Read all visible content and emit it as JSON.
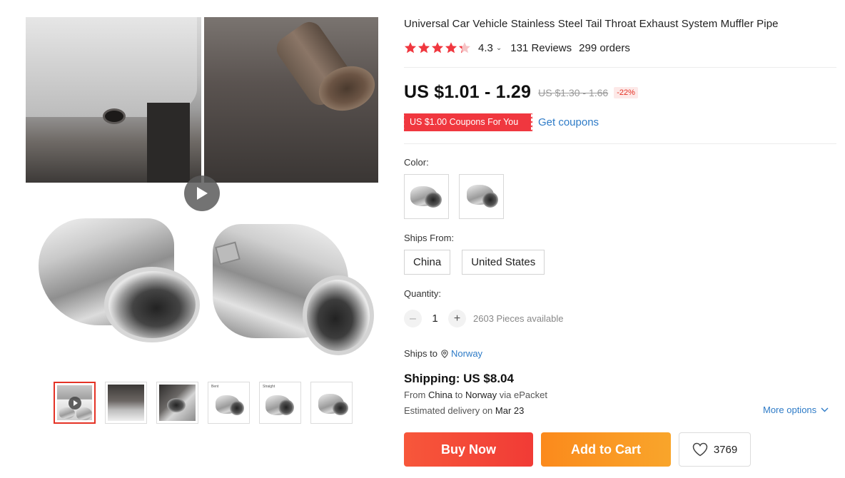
{
  "product": {
    "title": "Universal Car Vehicle Stainless Steel Tail Throat Exhaust System Muffler Pipe",
    "rating": "4.3",
    "rating_value": 4.3,
    "reviews": "131 Reviews",
    "orders": "299 orders"
  },
  "price": {
    "current": "US $1.01 - 1.29",
    "original": "US $1.30 - 1.66",
    "discount": "-22%"
  },
  "coupon": {
    "tag": "US $1.00 Coupons For You",
    "link": "Get coupons"
  },
  "color": {
    "label": "Color:",
    "options": [
      "swatch-bent-tip",
      "swatch-straight-tip"
    ]
  },
  "ships_from": {
    "label": "Ships From:",
    "options": [
      "China",
      "United States"
    ]
  },
  "quantity": {
    "label": "Quantity:",
    "value": "1",
    "available": "2603 Pieces available"
  },
  "ships_to": {
    "label": "Ships to",
    "country": "Norway"
  },
  "shipping": {
    "title": "Shipping: US $8.04",
    "from_prefix": "From",
    "from": "China",
    "to_prefix": "to",
    "to": "Norway",
    "via": "via ePacket",
    "delivery_prefix": "Estimated delivery on",
    "delivery_date": "Mar 23",
    "more_options": "More options"
  },
  "actions": {
    "buy_now": "Buy Now",
    "add_to_cart": "Add to Cart",
    "wishlist_count": "3769"
  },
  "gallery": {
    "thumbnail_count": 6,
    "active_index": 0,
    "thumb_tags": [
      "",
      "",
      "",
      "Bent",
      "Straight",
      ""
    ]
  },
  "colors": {
    "accent_red": "#e43225",
    "buy_now": "#f13b36",
    "add_to_cart": "#fb8a1c",
    "link_blue": "#2e7bc7",
    "star": "#f0373f"
  },
  "icons": [
    "play-icon",
    "star-icon",
    "chevron-down-icon",
    "location-pin-icon",
    "minus-icon",
    "plus-icon",
    "heart-icon"
  ]
}
